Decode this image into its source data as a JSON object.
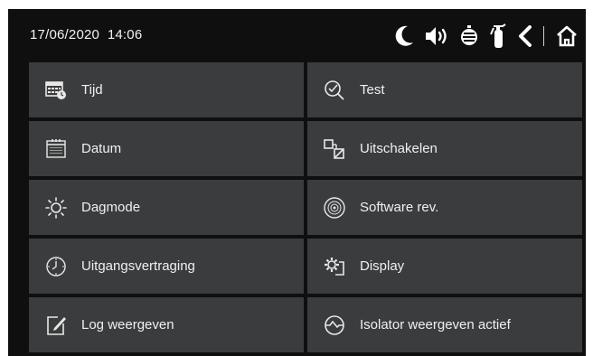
{
  "status": {
    "date": "17/06/2020",
    "time": "14:06",
    "icons": [
      "moon-icon",
      "speaker-icon",
      "sounder-icon",
      "extinguisher-icon",
      "back-icon",
      "home-icon"
    ]
  },
  "menu": {
    "items": [
      {
        "label": "Tijd",
        "icon": "calendar-clock-icon"
      },
      {
        "label": "Test",
        "icon": "test-magnifier-icon"
      },
      {
        "label": "Datum",
        "icon": "calendar-icon"
      },
      {
        "label": "Uitschakelen",
        "icon": "disable-icon"
      },
      {
        "label": "Dagmode",
        "icon": "sun-icon"
      },
      {
        "label": "Software rev.",
        "icon": "disc-icon"
      },
      {
        "label": "Uitgangsvertraging",
        "icon": "clock-icon"
      },
      {
        "label": "Display",
        "icon": "gear-display-icon"
      },
      {
        "label": "Log weergeven",
        "icon": "edit-log-icon"
      },
      {
        "label": "Isolator weergeven actief",
        "icon": "isolator-icon"
      }
    ]
  },
  "colors": {
    "background": "#0f0f10",
    "tile": "#3b3c3d",
    "text": "#f0f0f0"
  }
}
